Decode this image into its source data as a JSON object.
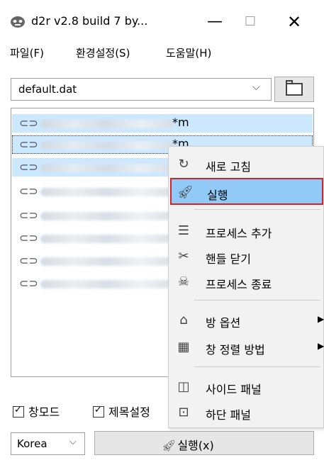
{
  "window": {
    "title": "d2r v2.8 build 7 by...",
    "minimize_glyph": "—",
    "maximize_glyph": "☐",
    "close_glyph": "✕"
  },
  "menu": [
    "파일(F)",
    "환경설정(S)",
    "도움말(H)"
  ],
  "file_select": {
    "value": "default.dat",
    "icon": "chevron-down-icon"
  },
  "folder_button": {
    "icon": "folder-icon"
  },
  "accounts": [
    {
      "suffix": "*m",
      "selected": true
    },
    {
      "suffix": "*m",
      "selected": true
    },
    {
      "suffix": "*",
      "selected": true
    },
    {
      "suffix": "*",
      "selected": false
    },
    {
      "suffix": "*",
      "selected": false
    },
    {
      "suffix": "*",
      "selected": false
    },
    {
      "suffix": "*",
      "selected": false
    },
    {
      "suffix": "*",
      "selected": false
    }
  ],
  "checkboxes": [
    {
      "label": "창모드",
      "checked": true
    },
    {
      "label": "제목설정",
      "checked": true
    }
  ],
  "region_select": {
    "value": "Korea"
  },
  "run_button": {
    "label": "실행(x)"
  },
  "context_menu": {
    "refresh": "새로 고침",
    "run": "실행",
    "add_process": "프로세스 추가",
    "close_handle": "핸들 닫기",
    "end_process": "프로세스 종료",
    "room_options": "방 옵션",
    "window_arrange": "창 정렬 방법",
    "side_panel": "사이드 패널",
    "bottom_panel": "하단 패널"
  },
  "colors": {
    "selection": "#cce8ff",
    "highlight": "#91c9f7",
    "highlight_border": "#d0232a"
  }
}
